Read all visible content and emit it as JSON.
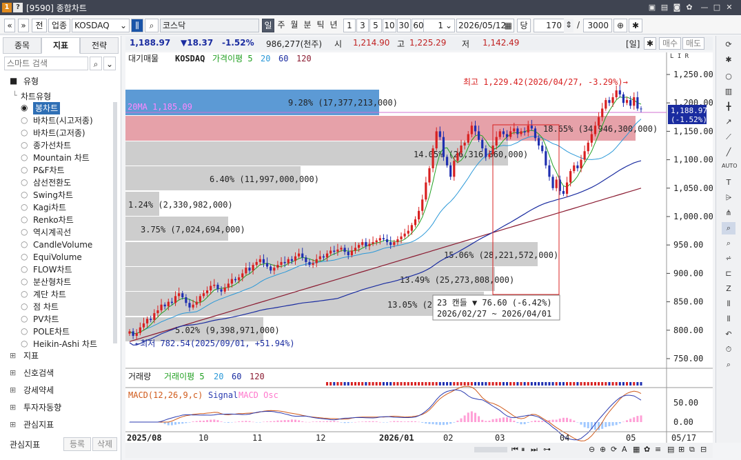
{
  "window": {
    "badge1": "1",
    "badge2": "?",
    "title": "[9590] 종합차트"
  },
  "toolbar": {
    "nav_prev": "«",
    "nav_down": "»",
    "chk_jeon": "전",
    "chk_upjong": "업종",
    "market": "KOSDAQ",
    "market_name": "코스닥",
    "periods": [
      "일",
      "주",
      "월",
      "분",
      "틱",
      "년"
    ],
    "nums": [
      "1",
      "3",
      "5",
      "10",
      "30",
      "60"
    ],
    "count": "1",
    "date": "2026/05/12",
    "dang": "당",
    "bars": "170",
    "slash": "/",
    "total": "3000"
  },
  "leftpanel": {
    "tabs": [
      "종목",
      "지표",
      "전략"
    ],
    "search_placeholder": "스마트 검색",
    "section": "유형",
    "tree_root": "차트유형",
    "items": [
      "봉차트",
      "바차트(시고저종)",
      "바차트(고저종)",
      "종가선차트",
      "Mountain 차트",
      "P&F차트",
      "삼선전환도",
      "Swing차트",
      "Kagi차트",
      "Renko차트",
      "역시계곡선",
      "CandleVolume",
      "EquiVolume",
      "FLOW차트",
      "분산형차트",
      "계단 차트",
      "점 차트",
      "PV차트",
      "POLE차트",
      "Heikin-Ashi 차트"
    ],
    "sections": [
      "지표",
      "신호검색",
      "강세약세",
      "투자자동향",
      "관심지표"
    ],
    "footer": "관심지표",
    "btn_add": "등록",
    "btn_del": "삭제"
  },
  "pricebar": {
    "price": "1,188.97",
    "change": "▼18.37",
    "pct": "-1.52%",
    "volume": "986,277(천주)",
    "open_lbl": "시",
    "open": "1,214.90",
    "high_lbl": "고",
    "high": "1,225.29",
    "low_lbl": "저",
    "low": "1,142.49",
    "period": "[일]",
    "btn_buy": "매수",
    "btn_sell": "매도"
  },
  "legend": {
    "a": "대기매물",
    "b": "KOSDAQ",
    "c": "가격이평 5",
    "d": "20",
    "e": "60",
    "f": "120"
  },
  "vol_legend": {
    "a": "거래량",
    "b": "거래이평 5",
    "c": "20",
    "d": "60",
    "e": "120"
  },
  "macd_legend": {
    "a": "MACD(12,26,9,c)",
    "b": "Signal",
    "c": "MACD Osc"
  },
  "annotations": {
    "high": "최고 1,229.42(2026/04/27, -3.29%)→",
    "low": "←최저 782.54(2025/09/01, +51.94%)",
    "ma20": "20MA 1,185.09",
    "tip1": "23 캔들 ▼ 76.60 (-6.42%)",
    "tip2": "2026/02/27 ~ 2026/04/01",
    "last_price": "1,188.97",
    "last_pct": "(-1.52%)",
    "axis_lir": "L I R"
  },
  "vp": [
    {
      "label": "9.28% (17,377,213,000)"
    },
    {
      "label": "18.65% (34,946,300,000)"
    },
    {
      "label": "14.05% (26,316,860,000)"
    },
    {
      "label": "6.40% (11,997,000,000)"
    },
    {
      "label": "1.24% (2,330,982,000)"
    },
    {
      "label": "3.75% (7,024,694,000)"
    },
    {
      "label": "15.06% (28,221,572,000)"
    },
    {
      "label": "13.49% (25,273,808,000)"
    },
    {
      "label": "13.05% (24,"
    },
    {
      "label": "5.02% (9,398,971,000)"
    }
  ],
  "yaxis": [
    "1,250.00",
    "1,200.00",
    "1,150.00",
    "1,100.00",
    "1,050.00",
    "1,000.00",
    "950.00",
    "900.00",
    "850.00",
    "800.00",
    "750.00"
  ],
  "macd_axis": [
    "50.00",
    "0.00"
  ],
  "xaxis": [
    "2025/08",
    "10",
    "11",
    "12",
    "2026/01",
    "02",
    "03",
    "04",
    "05",
    "05/17"
  ],
  "colors": {
    "up": "#d82020",
    "down": "#1f2fb0",
    "ma5": "#22a022",
    "ma20": "#2a98d8",
    "ma60": "#1a2ca0",
    "ma120": "#8a1a30",
    "vp_blue": "#4a8fd0",
    "vp_red": "#e2909a",
    "vp_gray": "#c8c8c8"
  }
}
